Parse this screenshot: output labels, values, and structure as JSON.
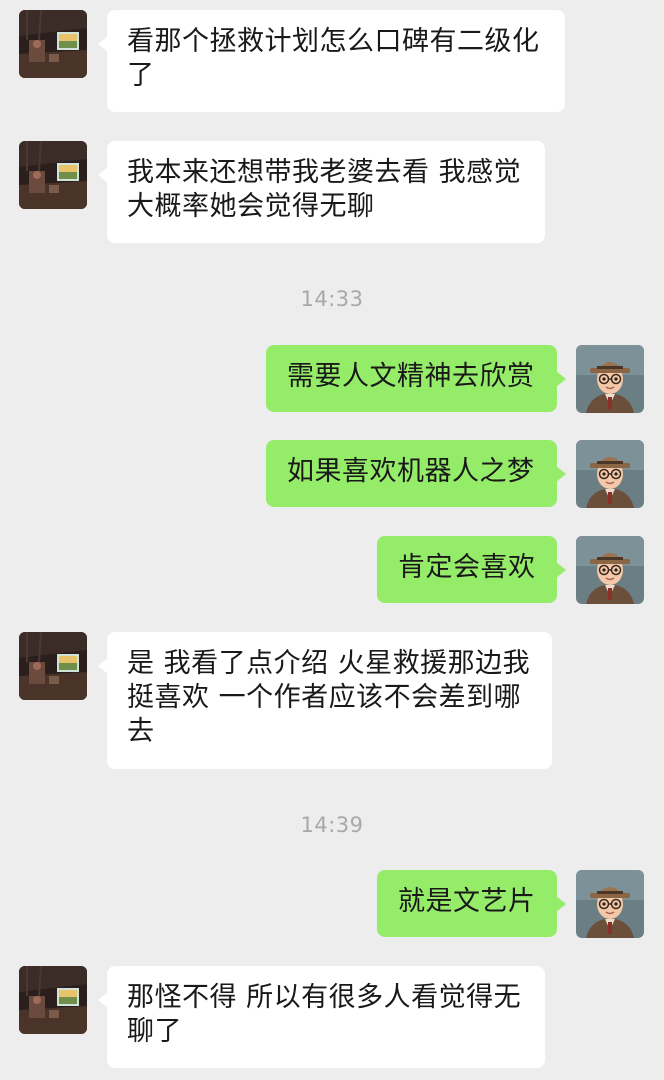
{
  "colors": {
    "background": "#ededed",
    "incoming_bubble": "#ffffff",
    "outgoing_bubble": "#95ec69",
    "timestamp_text": "#a8a8a8"
  },
  "messages": [
    {
      "side": "left",
      "avatar": "dark-room-window-avatar",
      "text": "看那个拯救计划怎么口碑有二级化了"
    },
    {
      "side": "left",
      "avatar": "dark-room-window-avatar",
      "text": "我本来还想带我老婆去看 我感觉大概率她会觉得无聊"
    },
    {
      "type": "time",
      "text": "14:33"
    },
    {
      "side": "right",
      "avatar": "cartoon-man-hat-glasses-avatar",
      "text": "需要人文精神去欣赏"
    },
    {
      "side": "right",
      "avatar": "cartoon-man-hat-glasses-avatar",
      "text": "如果喜欢机器人之梦"
    },
    {
      "side": "right",
      "avatar": "cartoon-man-hat-glasses-avatar",
      "text": "肯定会喜欢"
    },
    {
      "side": "left",
      "avatar": "dark-room-window-avatar",
      "text": "是 我看了点介绍 火星救援那边我挺喜欢 一个作者应该不会差到哪去"
    },
    {
      "type": "time",
      "text": "14:39"
    },
    {
      "side": "right",
      "avatar": "cartoon-man-hat-glasses-avatar",
      "text": "就是文艺片"
    },
    {
      "side": "left",
      "avatar": "dark-room-window-avatar",
      "text": "那怪不得 所以有很多人看觉得无聊了"
    }
  ]
}
